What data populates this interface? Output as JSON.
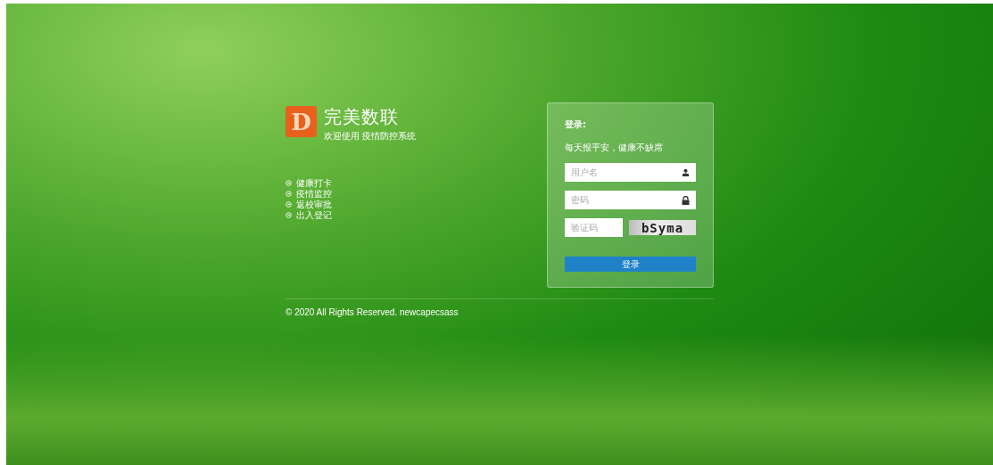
{
  "brand": {
    "logo_letter": "D",
    "name": "完美数联",
    "subtitle": "欢迎使用 疫情防控系统"
  },
  "menu": [
    "健康打卡",
    "疫情监控",
    "返校审批",
    "出入登记"
  ],
  "login": {
    "title": "登录:",
    "slogan": "每天报平安，健康不缺席",
    "username": {
      "placeholder": "用户名"
    },
    "password": {
      "placeholder": "密码"
    },
    "captcha": {
      "placeholder": "验证码",
      "code": "bSyma"
    },
    "submit": "登录"
  },
  "footer": "© 2020 All Rights Reserved. newcapecsass"
}
